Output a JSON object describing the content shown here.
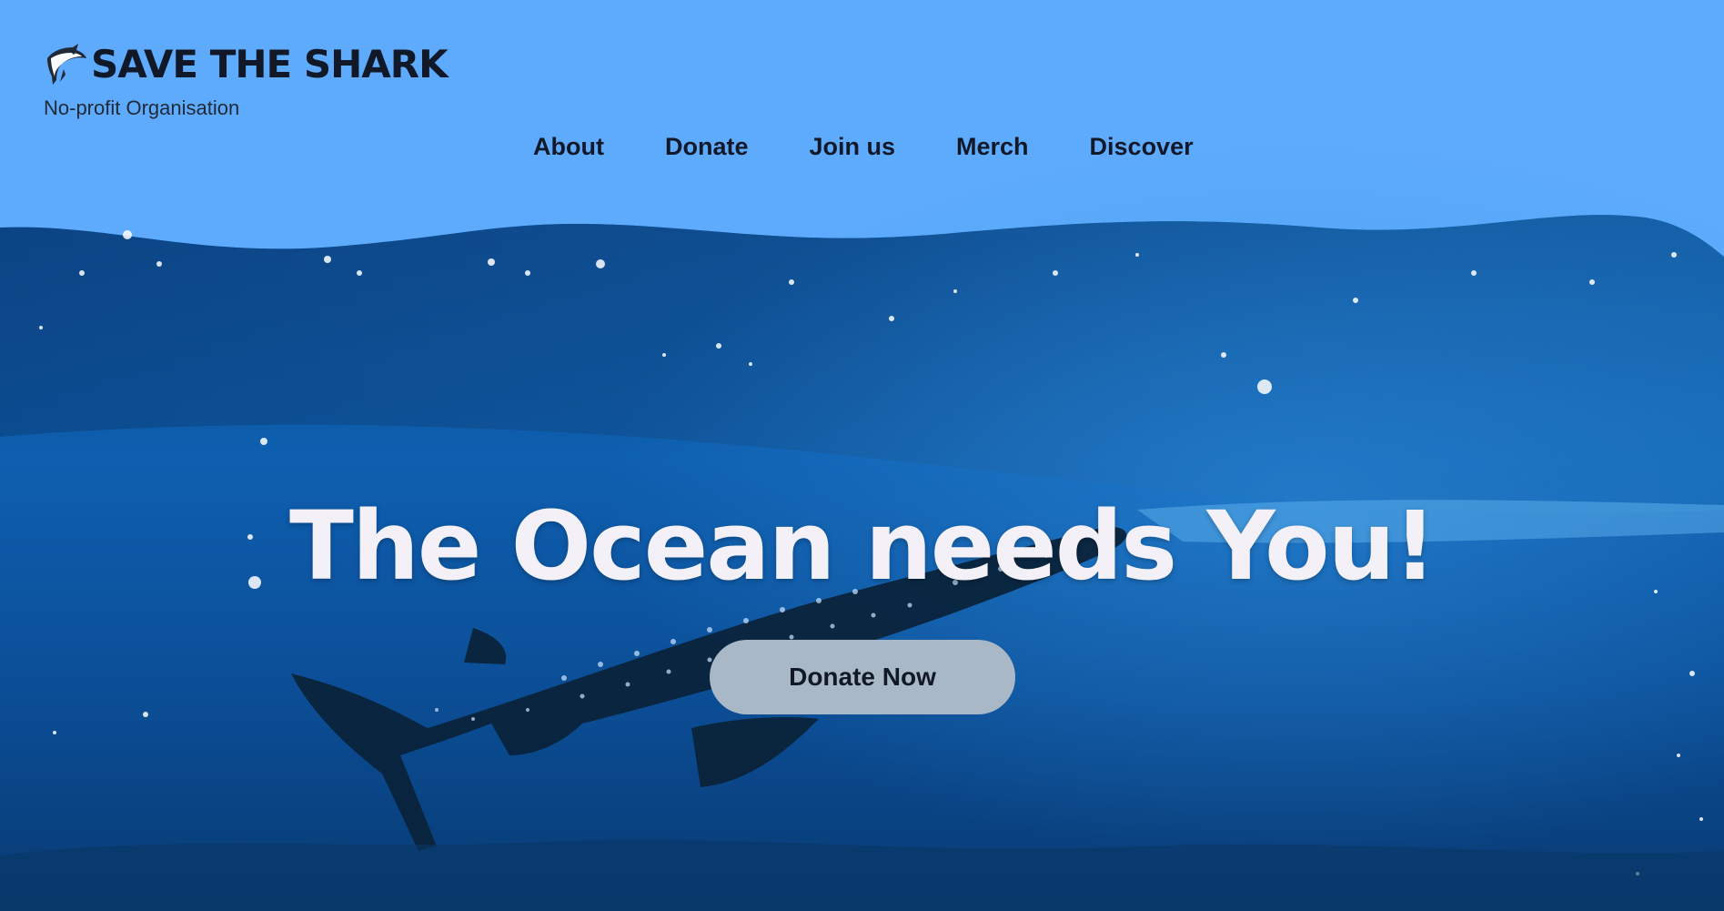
{
  "brand": {
    "title": "SAVE THE SHARK",
    "subtitle": "No-profit Organisation",
    "logo_icon": "shark-icon"
  },
  "nav": {
    "items": [
      {
        "label": "About"
      },
      {
        "label": "Donate"
      },
      {
        "label": "Join us"
      },
      {
        "label": "Merch"
      },
      {
        "label": "Discover"
      }
    ]
  },
  "hero": {
    "headline": "The Ocean needs You!",
    "cta_label": "Donate Now",
    "image": "whale-shark-underwater-photo"
  },
  "colors": {
    "header_bg": "#5eabfd",
    "ocean_deep": "#0b3a74",
    "ocean_mid": "#0f5aa8",
    "headline": "#f3f1f7",
    "cta_bg": "#a9b8c6",
    "text_dark": "#111827"
  }
}
